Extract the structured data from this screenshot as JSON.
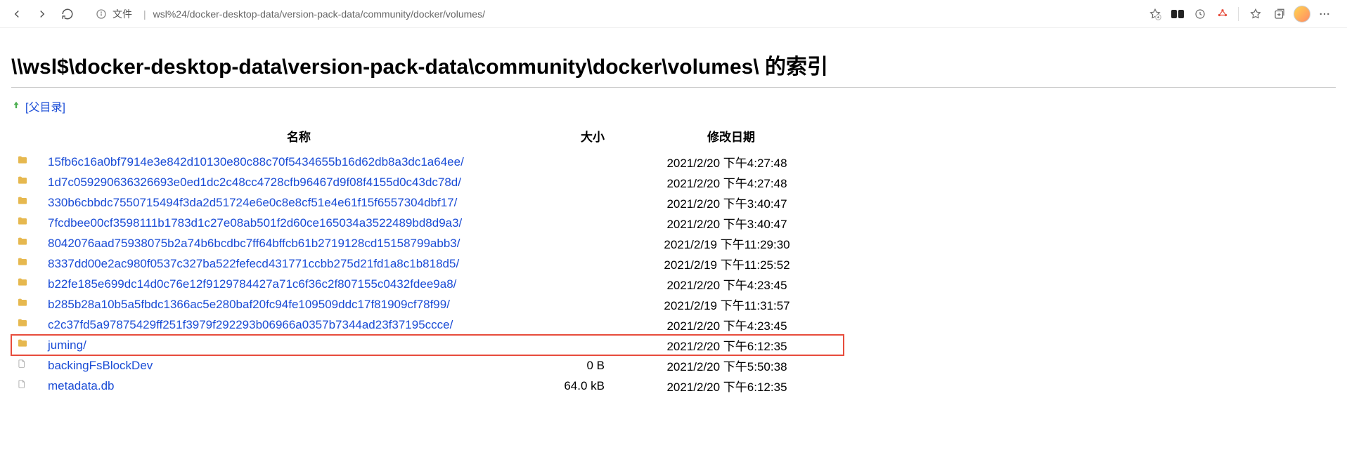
{
  "toolbar": {
    "file_label": "文件",
    "url": "wsl%24/docker-desktop-data/version-pack-data/community/docker/volumes/"
  },
  "page": {
    "title": "\\\\wsl$\\docker-desktop-data\\version-pack-data\\community\\docker\\volumes\\ 的索引",
    "parent_label": "[父目录]"
  },
  "columns": {
    "name": "名称",
    "size": "大小",
    "date": "修改日期"
  },
  "rows": [
    {
      "type": "folder",
      "name": "15fb6c16a0bf7914e3e842d10130e80c88c70f5434655b16d62db8a3dc1a64ee/",
      "size": "",
      "date": "2021/2/20 下午4:27:48",
      "hi": false
    },
    {
      "type": "folder",
      "name": "1d7c059290636326693e0ed1dc2c48cc4728cfb96467d9f08f4155d0c43dc78d/",
      "size": "",
      "date": "2021/2/20 下午4:27:48",
      "hi": false
    },
    {
      "type": "folder",
      "name": "330b6cbbdc7550715494f3da2d51724e6e0c8e8cf51e4e61f15f6557304dbf17/",
      "size": "",
      "date": "2021/2/20 下午3:40:47",
      "hi": false
    },
    {
      "type": "folder",
      "name": "7fcdbee00cf3598111b1783d1c27e08ab501f2d60ce165034a3522489bd8d9a3/",
      "size": "",
      "date": "2021/2/20 下午3:40:47",
      "hi": false
    },
    {
      "type": "folder",
      "name": "8042076aad75938075b2a74b6bcdbc7ff64bffcb61b2719128cd15158799abb3/",
      "size": "",
      "date": "2021/2/19 下午11:29:30",
      "hi": false
    },
    {
      "type": "folder",
      "name": "8337dd00e2ac980f0537c327ba522fefecd431771ccbb275d21fd1a8c1b818d5/",
      "size": "",
      "date": "2021/2/19 下午11:25:52",
      "hi": false
    },
    {
      "type": "folder",
      "name": "b22fe185e699dc14d0c76e12f9129784427a71c6f36c2f807155c0432fdee9a8/",
      "size": "",
      "date": "2021/2/20 下午4:23:45",
      "hi": false
    },
    {
      "type": "folder",
      "name": "b285b28a10b5a5fbdc1366ac5e280baf20fc94fe109509ddc17f81909cf78f99/",
      "size": "",
      "date": "2021/2/19 下午11:31:57",
      "hi": false
    },
    {
      "type": "folder",
      "name": "c2c37fd5a97875429ff251f3979f292293b06966a0357b7344ad23f37195ccce/",
      "size": "",
      "date": "2021/2/20 下午4:23:45",
      "hi": false
    },
    {
      "type": "folder",
      "name": "juming/",
      "size": "",
      "date": "2021/2/20 下午6:12:35",
      "hi": true
    },
    {
      "type": "file",
      "name": "backingFsBlockDev",
      "size": "0 B",
      "date": "2021/2/20 下午5:50:38",
      "hi": false
    },
    {
      "type": "file",
      "name": "metadata.db",
      "size": "64.0 kB",
      "date": "2021/2/20 下午6:12:35",
      "hi": false
    }
  ]
}
